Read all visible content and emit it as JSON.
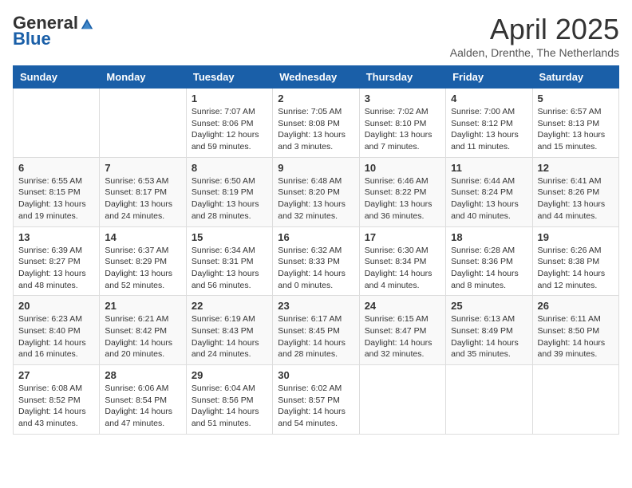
{
  "header": {
    "logo_general": "General",
    "logo_blue": "Blue",
    "title": "April 2025",
    "subtitle": "Aalden, Drenthe, The Netherlands"
  },
  "weekdays": [
    "Sunday",
    "Monday",
    "Tuesday",
    "Wednesday",
    "Thursday",
    "Friday",
    "Saturday"
  ],
  "weeks": [
    [
      {
        "day": "",
        "info": ""
      },
      {
        "day": "",
        "info": ""
      },
      {
        "day": "1",
        "info": "Sunrise: 7:07 AM\nSunset: 8:06 PM\nDaylight: 12 hours and 59 minutes."
      },
      {
        "day": "2",
        "info": "Sunrise: 7:05 AM\nSunset: 8:08 PM\nDaylight: 13 hours and 3 minutes."
      },
      {
        "day": "3",
        "info": "Sunrise: 7:02 AM\nSunset: 8:10 PM\nDaylight: 13 hours and 7 minutes."
      },
      {
        "day": "4",
        "info": "Sunrise: 7:00 AM\nSunset: 8:12 PM\nDaylight: 13 hours and 11 minutes."
      },
      {
        "day": "5",
        "info": "Sunrise: 6:57 AM\nSunset: 8:13 PM\nDaylight: 13 hours and 15 minutes."
      }
    ],
    [
      {
        "day": "6",
        "info": "Sunrise: 6:55 AM\nSunset: 8:15 PM\nDaylight: 13 hours and 19 minutes."
      },
      {
        "day": "7",
        "info": "Sunrise: 6:53 AM\nSunset: 8:17 PM\nDaylight: 13 hours and 24 minutes."
      },
      {
        "day": "8",
        "info": "Sunrise: 6:50 AM\nSunset: 8:19 PM\nDaylight: 13 hours and 28 minutes."
      },
      {
        "day": "9",
        "info": "Sunrise: 6:48 AM\nSunset: 8:20 PM\nDaylight: 13 hours and 32 minutes."
      },
      {
        "day": "10",
        "info": "Sunrise: 6:46 AM\nSunset: 8:22 PM\nDaylight: 13 hours and 36 minutes."
      },
      {
        "day": "11",
        "info": "Sunrise: 6:44 AM\nSunset: 8:24 PM\nDaylight: 13 hours and 40 minutes."
      },
      {
        "day": "12",
        "info": "Sunrise: 6:41 AM\nSunset: 8:26 PM\nDaylight: 13 hours and 44 minutes."
      }
    ],
    [
      {
        "day": "13",
        "info": "Sunrise: 6:39 AM\nSunset: 8:27 PM\nDaylight: 13 hours and 48 minutes."
      },
      {
        "day": "14",
        "info": "Sunrise: 6:37 AM\nSunset: 8:29 PM\nDaylight: 13 hours and 52 minutes."
      },
      {
        "day": "15",
        "info": "Sunrise: 6:34 AM\nSunset: 8:31 PM\nDaylight: 13 hours and 56 minutes."
      },
      {
        "day": "16",
        "info": "Sunrise: 6:32 AM\nSunset: 8:33 PM\nDaylight: 14 hours and 0 minutes."
      },
      {
        "day": "17",
        "info": "Sunrise: 6:30 AM\nSunset: 8:34 PM\nDaylight: 14 hours and 4 minutes."
      },
      {
        "day": "18",
        "info": "Sunrise: 6:28 AM\nSunset: 8:36 PM\nDaylight: 14 hours and 8 minutes."
      },
      {
        "day": "19",
        "info": "Sunrise: 6:26 AM\nSunset: 8:38 PM\nDaylight: 14 hours and 12 minutes."
      }
    ],
    [
      {
        "day": "20",
        "info": "Sunrise: 6:23 AM\nSunset: 8:40 PM\nDaylight: 14 hours and 16 minutes."
      },
      {
        "day": "21",
        "info": "Sunrise: 6:21 AM\nSunset: 8:42 PM\nDaylight: 14 hours and 20 minutes."
      },
      {
        "day": "22",
        "info": "Sunrise: 6:19 AM\nSunset: 8:43 PM\nDaylight: 14 hours and 24 minutes."
      },
      {
        "day": "23",
        "info": "Sunrise: 6:17 AM\nSunset: 8:45 PM\nDaylight: 14 hours and 28 minutes."
      },
      {
        "day": "24",
        "info": "Sunrise: 6:15 AM\nSunset: 8:47 PM\nDaylight: 14 hours and 32 minutes."
      },
      {
        "day": "25",
        "info": "Sunrise: 6:13 AM\nSunset: 8:49 PM\nDaylight: 14 hours and 35 minutes."
      },
      {
        "day": "26",
        "info": "Sunrise: 6:11 AM\nSunset: 8:50 PM\nDaylight: 14 hours and 39 minutes."
      }
    ],
    [
      {
        "day": "27",
        "info": "Sunrise: 6:08 AM\nSunset: 8:52 PM\nDaylight: 14 hours and 43 minutes."
      },
      {
        "day": "28",
        "info": "Sunrise: 6:06 AM\nSunset: 8:54 PM\nDaylight: 14 hours and 47 minutes."
      },
      {
        "day": "29",
        "info": "Sunrise: 6:04 AM\nSunset: 8:56 PM\nDaylight: 14 hours and 51 minutes."
      },
      {
        "day": "30",
        "info": "Sunrise: 6:02 AM\nSunset: 8:57 PM\nDaylight: 14 hours and 54 minutes."
      },
      {
        "day": "",
        "info": ""
      },
      {
        "day": "",
        "info": ""
      },
      {
        "day": "",
        "info": ""
      }
    ]
  ]
}
